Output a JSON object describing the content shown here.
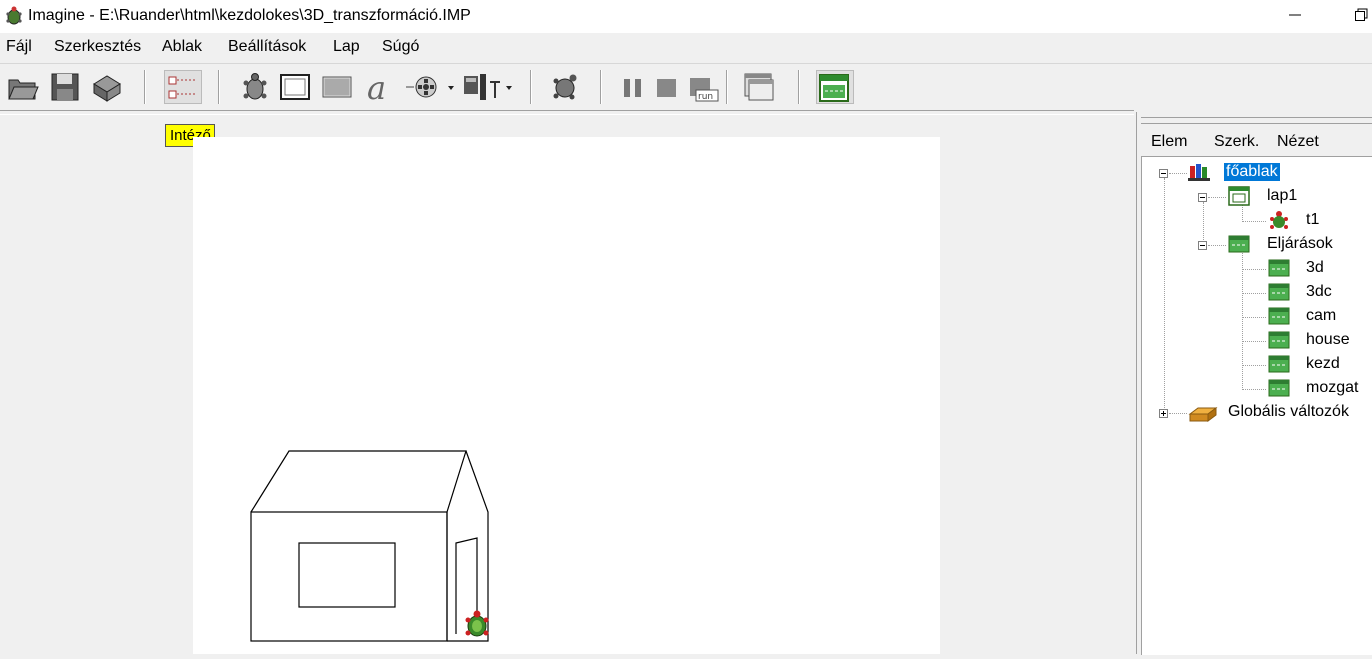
{
  "window": {
    "title": "Imagine - E:\\Ruander\\html\\kezdolokes\\3D_transzformáció.IMP"
  },
  "menu": [
    "Fájl",
    "Szerkesztés",
    "Ablak",
    "Beállítások",
    "Lap",
    "Súgó"
  ],
  "tooltip": "Intéző",
  "right_panel": {
    "menu": [
      "Elem",
      "Szerk.",
      "Nézet"
    ],
    "tree": {
      "root": "főablak",
      "page": "lap1",
      "turtle": "t1",
      "procedures_label": "Eljárások",
      "procedures": [
        "3d",
        "3dc",
        "cam",
        "house",
        "kezd",
        "mozgat"
      ],
      "globals": "Globális változók"
    }
  },
  "colors": {
    "selection": "#0078d7",
    "tooltip": "#ffff00",
    "turtle_green": "#3a8a2a"
  }
}
